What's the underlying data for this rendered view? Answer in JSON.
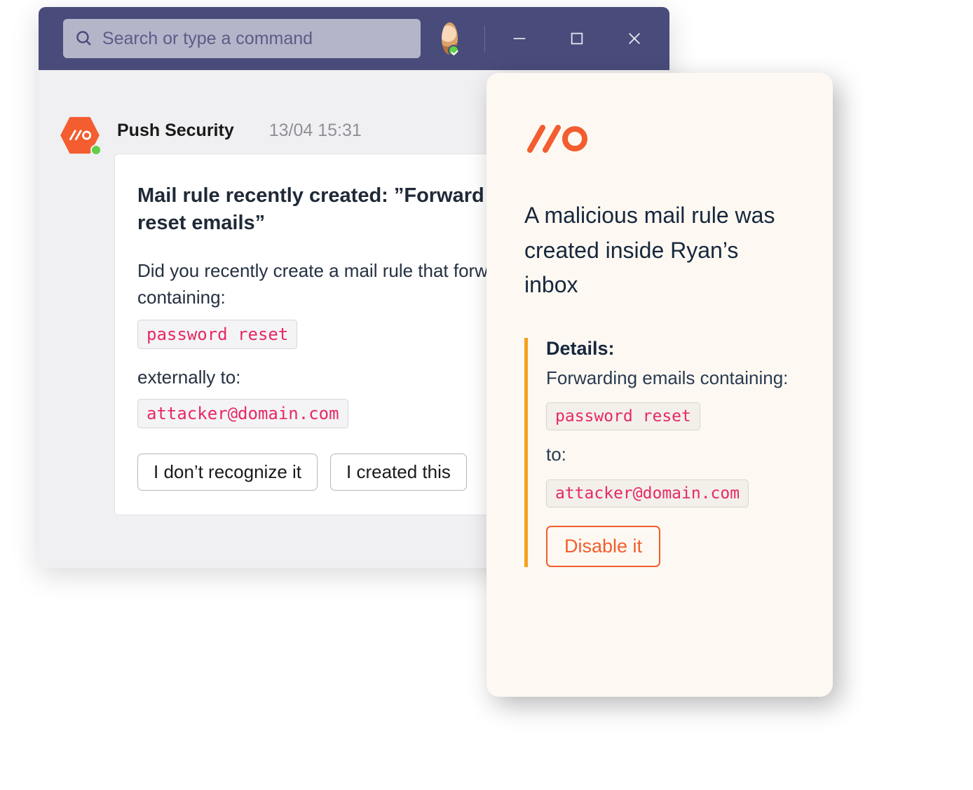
{
  "titlebar": {
    "search_placeholder": "Search or type a command"
  },
  "message": {
    "sender": "Push Security",
    "timestamp": "13/04  15:31",
    "card": {
      "title": "Mail rule recently created: ”Forward password reset emails”",
      "question": "Did you recently create a mail rule that forwards mail containing:",
      "keyword": "password reset",
      "externally_label": "externally to:",
      "recipient": "attacker@domain.com",
      "btn_no": "I don’t recognize it",
      "btn_yes": "I created this"
    }
  },
  "panel": {
    "headline": "A malicious mail rule was created inside Ryan’s inbox",
    "details_label": "Details:",
    "forwarding_label": "Forwarding emails containing:",
    "keyword": "password reset",
    "to_label": "to:",
    "recipient": "attacker@domain.com",
    "disable_label": "Disable it"
  }
}
